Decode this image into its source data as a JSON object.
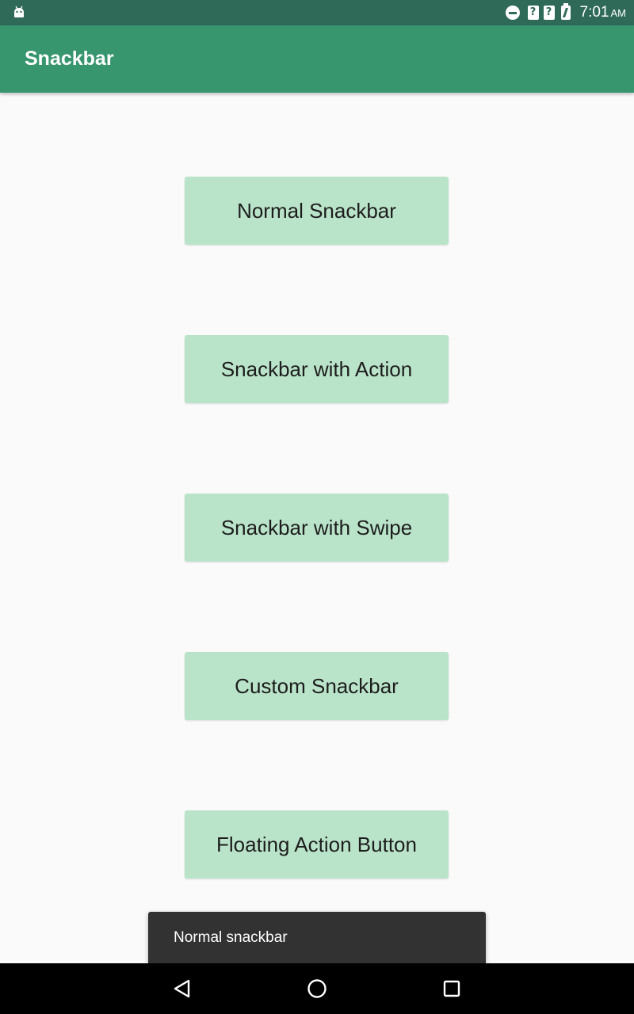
{
  "status_bar": {
    "time": "7:01",
    "ampm": "AM",
    "icons": [
      "android-icon",
      "do-not-disturb-icon",
      "signal-unknown-icon",
      "signal-unknown-icon",
      "battery-charging-icon"
    ]
  },
  "app_bar": {
    "title": "Snackbar",
    "color": "#38966f"
  },
  "buttons": [
    {
      "label": "Normal Snackbar"
    },
    {
      "label": "Snackbar with Action"
    },
    {
      "label": "Snackbar with Swipe"
    },
    {
      "label": "Custom Snackbar"
    },
    {
      "label": "Floating Action Button"
    }
  ],
  "snackbar": {
    "message": "Normal snackbar"
  },
  "nav_bar": {
    "icons": [
      "back-icon",
      "home-icon",
      "recents-icon"
    ]
  },
  "colors": {
    "status_bar": "#2f6a59",
    "button_bg": "#bae4ca",
    "snackbar_bg": "#323232"
  }
}
